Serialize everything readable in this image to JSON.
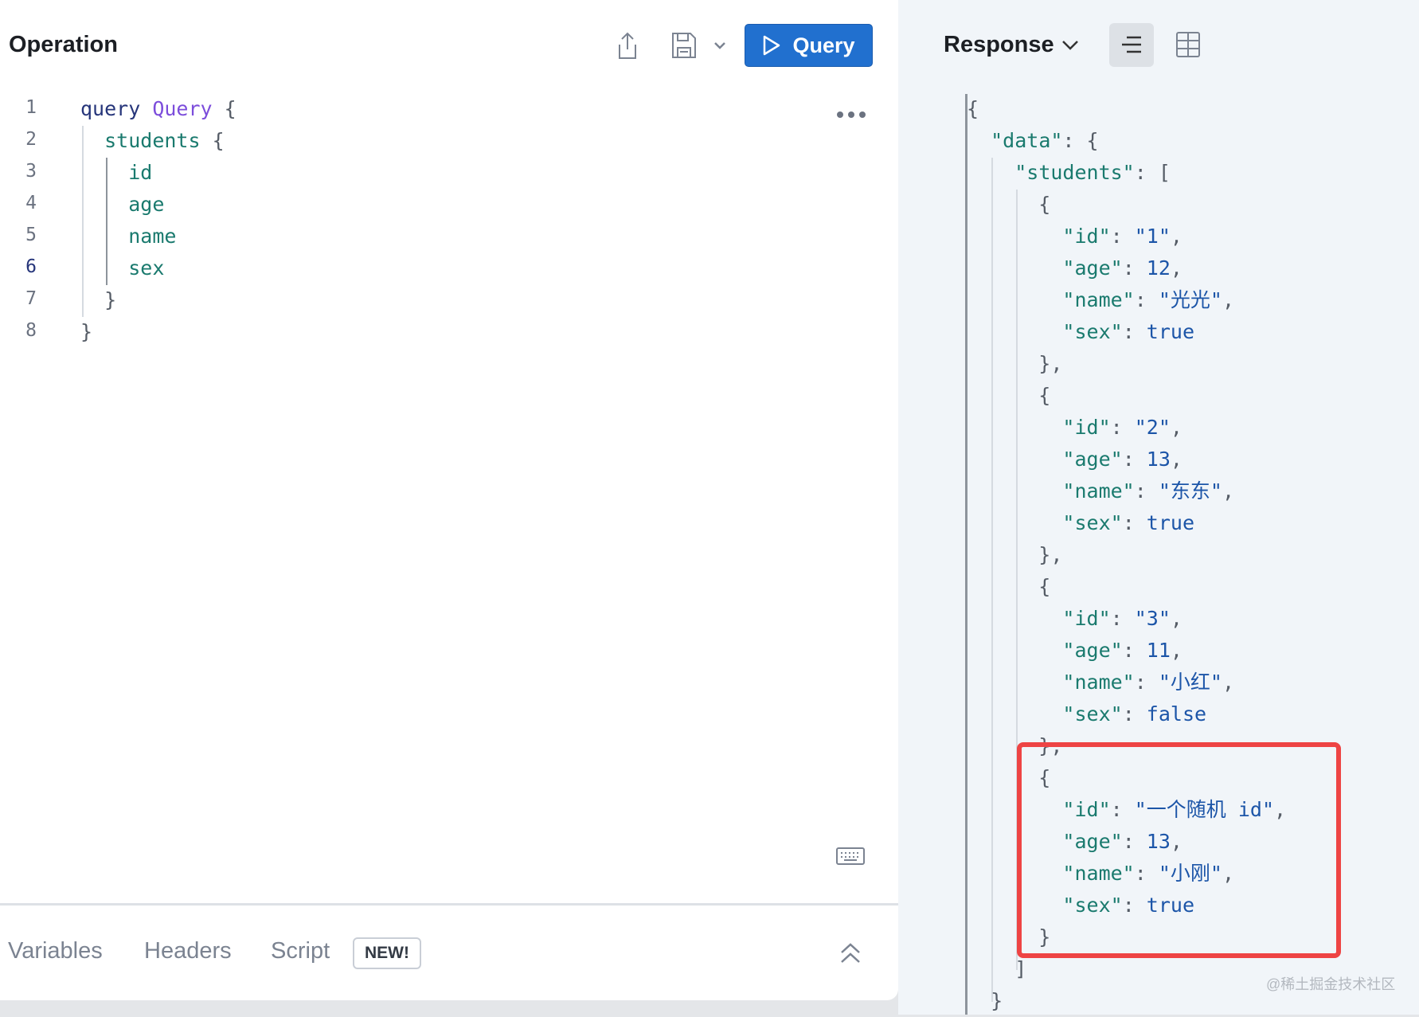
{
  "operation": {
    "title": "Operation",
    "query_button": "Query",
    "icons": [
      "share-icon",
      "save-icon",
      "chevron-down-icon",
      "play-icon",
      "more-icon",
      "keyboard-icon"
    ]
  },
  "editor": {
    "lines": [
      [
        [
          "kw",
          "query "
        ],
        [
          "op",
          "Query"
        ],
        [
          "p",
          " {"
        ]
      ],
      [
        [
          "p",
          "  "
        ],
        [
          "fld",
          "students"
        ],
        [
          "p",
          " {"
        ]
      ],
      [
        [
          "p",
          "    "
        ],
        [
          "fld",
          "id"
        ]
      ],
      [
        [
          "p",
          "    "
        ],
        [
          "fld",
          "age"
        ]
      ],
      [
        [
          "p",
          "    "
        ],
        [
          "fld",
          "name"
        ]
      ],
      [
        [
          "p",
          "    "
        ],
        [
          "fld",
          "sex"
        ]
      ],
      [
        [
          "p",
          "  }"
        ]
      ],
      [
        [
          "p",
          "}"
        ]
      ]
    ],
    "line_numbers": [
      "1",
      "2",
      "3",
      "4",
      "5",
      "6",
      "7",
      "8"
    ]
  },
  "bottom_tabs": {
    "variables": "Variables",
    "headers": "Headers",
    "script": "Script",
    "new_badge": "NEW!"
  },
  "response": {
    "title": "Response",
    "lines": [
      [
        [
          "p",
          "{"
        ]
      ],
      [
        [
          "p",
          "  "
        ],
        [
          "k",
          "\"data\""
        ],
        [
          "p",
          ": {"
        ]
      ],
      [
        [
          "p",
          "    "
        ],
        [
          "k",
          "\"students\""
        ],
        [
          "p",
          ": ["
        ]
      ],
      [
        [
          "p",
          "      {"
        ]
      ],
      [
        [
          "p",
          "        "
        ],
        [
          "k",
          "\"id\""
        ],
        [
          "p",
          ": "
        ],
        [
          "v",
          "\"1\""
        ],
        [
          "p",
          ","
        ]
      ],
      [
        [
          "p",
          "        "
        ],
        [
          "k",
          "\"age\""
        ],
        [
          "p",
          ": "
        ],
        [
          "v",
          "12"
        ],
        [
          "p",
          ","
        ]
      ],
      [
        [
          "p",
          "        "
        ],
        [
          "k",
          "\"name\""
        ],
        [
          "p",
          ": "
        ],
        [
          "v",
          "\"光光\""
        ],
        [
          "p",
          ","
        ]
      ],
      [
        [
          "p",
          "        "
        ],
        [
          "k",
          "\"sex\""
        ],
        [
          "p",
          ": "
        ],
        [
          "v",
          "true"
        ]
      ],
      [
        [
          "p",
          "      },"
        ]
      ],
      [
        [
          "p",
          "      {"
        ]
      ],
      [
        [
          "p",
          "        "
        ],
        [
          "k",
          "\"id\""
        ],
        [
          "p",
          ": "
        ],
        [
          "v",
          "\"2\""
        ],
        [
          "p",
          ","
        ]
      ],
      [
        [
          "p",
          "        "
        ],
        [
          "k",
          "\"age\""
        ],
        [
          "p",
          ": "
        ],
        [
          "v",
          "13"
        ],
        [
          "p",
          ","
        ]
      ],
      [
        [
          "p",
          "        "
        ],
        [
          "k",
          "\"name\""
        ],
        [
          "p",
          ": "
        ],
        [
          "v",
          "\"东东\""
        ],
        [
          "p",
          ","
        ]
      ],
      [
        [
          "p",
          "        "
        ],
        [
          "k",
          "\"sex\""
        ],
        [
          "p",
          ": "
        ],
        [
          "v",
          "true"
        ]
      ],
      [
        [
          "p",
          "      },"
        ]
      ],
      [
        [
          "p",
          "      {"
        ]
      ],
      [
        [
          "p",
          "        "
        ],
        [
          "k",
          "\"id\""
        ],
        [
          "p",
          ": "
        ],
        [
          "v",
          "\"3\""
        ],
        [
          "p",
          ","
        ]
      ],
      [
        [
          "p",
          "        "
        ],
        [
          "k",
          "\"age\""
        ],
        [
          "p",
          ": "
        ],
        [
          "v",
          "11"
        ],
        [
          "p",
          ","
        ]
      ],
      [
        [
          "p",
          "        "
        ],
        [
          "k",
          "\"name\""
        ],
        [
          "p",
          ": "
        ],
        [
          "v",
          "\"小红\""
        ],
        [
          "p",
          ","
        ]
      ],
      [
        [
          "p",
          "        "
        ],
        [
          "k",
          "\"sex\""
        ],
        [
          "p",
          ": "
        ],
        [
          "v",
          "false"
        ]
      ],
      [
        [
          "p",
          "      },"
        ]
      ],
      [
        [
          "p",
          "      {"
        ]
      ],
      [
        [
          "p",
          "        "
        ],
        [
          "k",
          "\"id\""
        ],
        [
          "p",
          ": "
        ],
        [
          "v",
          "\"一个随机 id\""
        ],
        [
          "p",
          ","
        ]
      ],
      [
        [
          "p",
          "        "
        ],
        [
          "k",
          "\"age\""
        ],
        [
          "p",
          ": "
        ],
        [
          "v",
          "13"
        ],
        [
          "p",
          ","
        ]
      ],
      [
        [
          "p",
          "        "
        ],
        [
          "k",
          "\"name\""
        ],
        [
          "p",
          ": "
        ],
        [
          "v",
          "\"小刚\""
        ],
        [
          "p",
          ","
        ]
      ],
      [
        [
          "p",
          "        "
        ],
        [
          "k",
          "\"sex\""
        ],
        [
          "p",
          ": "
        ],
        [
          "v",
          "true"
        ]
      ],
      [
        [
          "p",
          "      }"
        ]
      ],
      [
        [
          "p",
          "    ]"
        ]
      ],
      [
        [
          "p",
          "  }"
        ]
      ]
    ]
  },
  "watermark": "@稀土掘金技术社区",
  "colors": {
    "accent": "#2170cf",
    "highlight": "#ee4444"
  }
}
